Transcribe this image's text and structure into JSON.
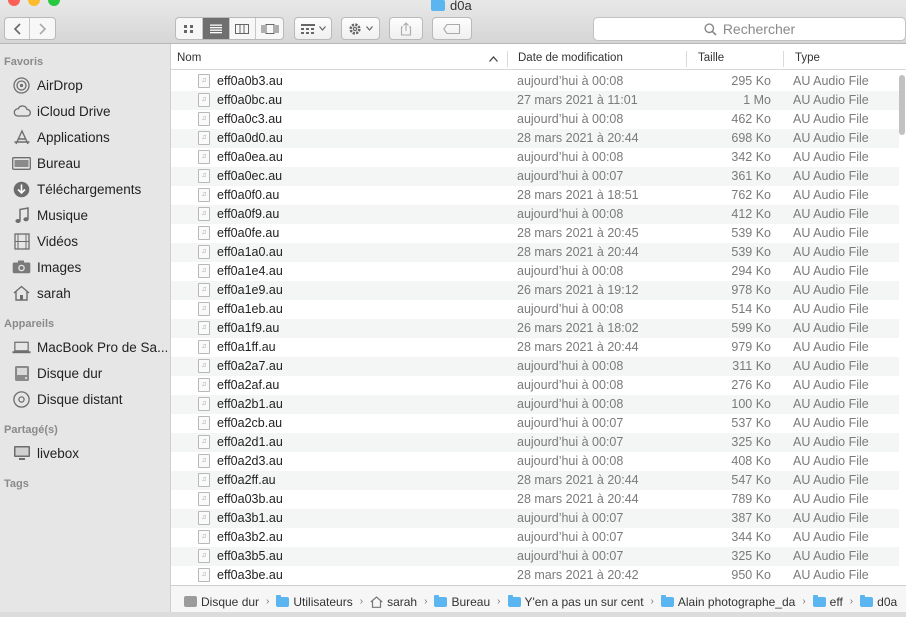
{
  "window": {
    "title": "d0a"
  },
  "toolbar": {
    "back_icon": "chevron-left-icon",
    "forward_icon": "chevron-right-icon",
    "view_modes": [
      "icon-view-icon",
      "list-view-icon",
      "column-view-icon",
      "gallery-view-icon"
    ],
    "active_view": "list",
    "group_icon": "group-icon",
    "action_icon": "gear-icon",
    "share_icon": "share-icon",
    "tag_icon": "tag-icon",
    "search_placeholder": "Rechercher"
  },
  "sidebar": {
    "sections": [
      {
        "title": "Favoris",
        "items": [
          {
            "label": "AirDrop",
            "icon": "airdrop-icon"
          },
          {
            "label": "iCloud Drive",
            "icon": "cloud-icon"
          },
          {
            "label": "Applications",
            "icon": "applications-icon"
          },
          {
            "label": "Bureau",
            "icon": "desktop-icon"
          },
          {
            "label": "Téléchargements",
            "icon": "download-icon"
          },
          {
            "label": "Musique",
            "icon": "music-icon"
          },
          {
            "label": "Vidéos",
            "icon": "film-icon"
          },
          {
            "label": "Images",
            "icon": "camera-icon"
          },
          {
            "label": "sarah",
            "icon": "home-icon"
          }
        ]
      },
      {
        "title": "Appareils",
        "items": [
          {
            "label": "MacBook Pro de Sa...",
            "icon": "laptop-icon"
          },
          {
            "label": "Disque dur",
            "icon": "harddisk-icon"
          },
          {
            "label": "Disque distant",
            "icon": "disc-icon"
          }
        ]
      },
      {
        "title": "Partagé(s)",
        "items": [
          {
            "label": "livebox",
            "icon": "display-icon"
          }
        ]
      },
      {
        "title": "Tags",
        "items": []
      }
    ]
  },
  "list": {
    "columns": {
      "name": "Nom",
      "date": "Date de modification",
      "size": "Taille",
      "type": "Type"
    },
    "sort_indicator": "sort-ascending-icon",
    "rows": [
      {
        "name": "eff0a0b3.au",
        "date": "aujourd’hui à 00:08",
        "size": "295 Ko",
        "type": "AU Audio File"
      },
      {
        "name": "eff0a0bc.au",
        "date": "27 mars 2021 à 11:01",
        "size": "1 Mo",
        "type": "AU Audio File"
      },
      {
        "name": "eff0a0c3.au",
        "date": "aujourd’hui à 00:08",
        "size": "462 Ko",
        "type": "AU Audio File"
      },
      {
        "name": "eff0a0d0.au",
        "date": "28 mars 2021 à 20:44",
        "size": "698 Ko",
        "type": "AU Audio File"
      },
      {
        "name": "eff0a0ea.au",
        "date": "aujourd’hui à 00:08",
        "size": "342 Ko",
        "type": "AU Audio File"
      },
      {
        "name": "eff0a0ec.au",
        "date": "aujourd’hui à 00:07",
        "size": "361 Ko",
        "type": "AU Audio File"
      },
      {
        "name": "eff0a0f0.au",
        "date": "28 mars 2021 à 18:51",
        "size": "762 Ko",
        "type": "AU Audio File"
      },
      {
        "name": "eff0a0f9.au",
        "date": "aujourd’hui à 00:08",
        "size": "412 Ko",
        "type": "AU Audio File"
      },
      {
        "name": "eff0a0fe.au",
        "date": "28 mars 2021 à 20:45",
        "size": "539 Ko",
        "type": "AU Audio File"
      },
      {
        "name": "eff0a1a0.au",
        "date": "28 mars 2021 à 20:44",
        "size": "539 Ko",
        "type": "AU Audio File"
      },
      {
        "name": "eff0a1e4.au",
        "date": "aujourd’hui à 00:08",
        "size": "294 Ko",
        "type": "AU Audio File"
      },
      {
        "name": "eff0a1e9.au",
        "date": "26 mars 2021 à 19:12",
        "size": "978 Ko",
        "type": "AU Audio File"
      },
      {
        "name": "eff0a1eb.au",
        "date": "aujourd’hui à 00:08",
        "size": "514 Ko",
        "type": "AU Audio File"
      },
      {
        "name": "eff0a1f9.au",
        "date": "26 mars 2021 à 18:02",
        "size": "599 Ko",
        "type": "AU Audio File"
      },
      {
        "name": "eff0a1ff.au",
        "date": "28 mars 2021 à 20:44",
        "size": "979 Ko",
        "type": "AU Audio File"
      },
      {
        "name": "eff0a2a7.au",
        "date": "aujourd’hui à 00:08",
        "size": "311 Ko",
        "type": "AU Audio File"
      },
      {
        "name": "eff0a2af.au",
        "date": "aujourd’hui à 00:08",
        "size": "276 Ko",
        "type": "AU Audio File"
      },
      {
        "name": "eff0a2b1.au",
        "date": "aujourd’hui à 00:08",
        "size": "100 Ko",
        "type": "AU Audio File"
      },
      {
        "name": "eff0a2cb.au",
        "date": "aujourd’hui à 00:07",
        "size": "537 Ko",
        "type": "AU Audio File"
      },
      {
        "name": "eff0a2d1.au",
        "date": "aujourd’hui à 00:07",
        "size": "325 Ko",
        "type": "AU Audio File"
      },
      {
        "name": "eff0a2d3.au",
        "date": "aujourd’hui à 00:08",
        "size": "408 Ko",
        "type": "AU Audio File"
      },
      {
        "name": "eff0a2ff.au",
        "date": "28 mars 2021 à 20:44",
        "size": "547 Ko",
        "type": "AU Audio File"
      },
      {
        "name": "eff0a03b.au",
        "date": "28 mars 2021 à 20:44",
        "size": "789 Ko",
        "type": "AU Audio File"
      },
      {
        "name": "eff0a3b1.au",
        "date": "aujourd’hui à 00:07",
        "size": "387 Ko",
        "type": "AU Audio File"
      },
      {
        "name": "eff0a3b2.au",
        "date": "aujourd’hui à 00:07",
        "size": "344 Ko",
        "type": "AU Audio File"
      },
      {
        "name": "eff0a3b5.au",
        "date": "aujourd’hui à 00:07",
        "size": "325 Ko",
        "type": "AU Audio File"
      },
      {
        "name": "eff0a3be.au",
        "date": "28 mars 2021 à 20:42",
        "size": "950 Ko",
        "type": "AU Audio File"
      }
    ]
  },
  "pathbar": {
    "items": [
      {
        "label": "Disque dur",
        "icon": "harddisk-icon"
      },
      {
        "label": "Utilisateurs",
        "icon": "folder-icon"
      },
      {
        "label": "sarah",
        "icon": "home-icon"
      },
      {
        "label": "Bureau",
        "icon": "folder-icon"
      },
      {
        "label": "Y'en a pas un sur cent",
        "icon": "folder-icon"
      },
      {
        "label": "Alain photographe_da",
        "icon": "folder-icon"
      },
      {
        "label": "eff",
        "icon": "folder-icon"
      },
      {
        "label": "d0a",
        "icon": "folder-icon"
      }
    ]
  },
  "colors": {
    "sidebar_bg": "#e6e6e6",
    "row_alt": "#f4f5f5",
    "folder": "#5ab5f0",
    "traffic_red": "#fc5f57",
    "traffic_yellow": "#fdbc2e",
    "traffic_green": "#28c840"
  }
}
